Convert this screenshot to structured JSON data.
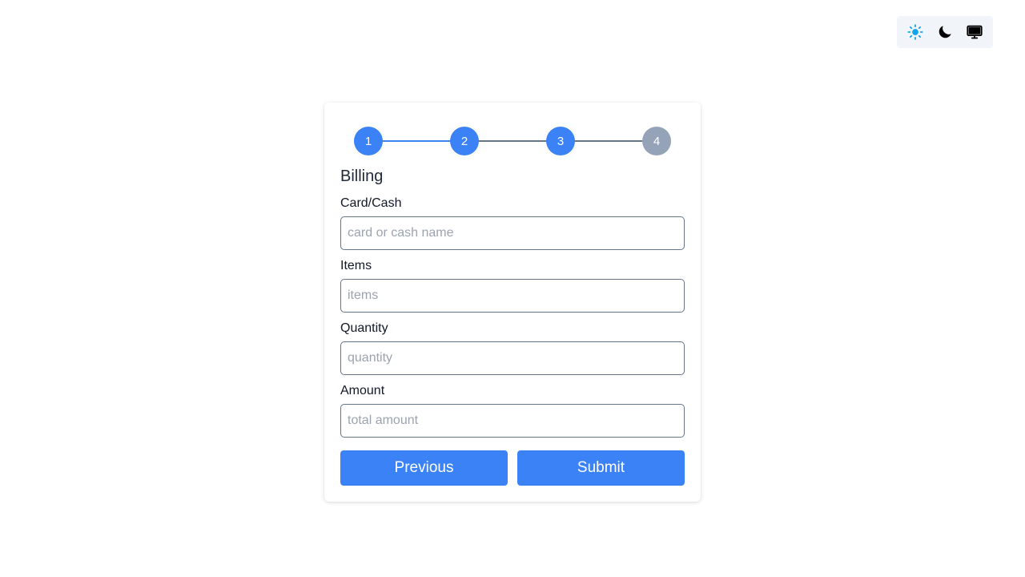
{
  "theme_switcher": {
    "options": [
      {
        "icon": "sun-icon",
        "active": true,
        "color": "#0ea5e9"
      },
      {
        "icon": "moon-icon",
        "active": false
      },
      {
        "icon": "monitor-icon",
        "active": false
      }
    ]
  },
  "stepper": {
    "steps": [
      "1",
      "2",
      "3",
      "4"
    ],
    "current_step": 3,
    "active_color": "#3b82f6",
    "pending_color": "#94a3b8"
  },
  "form": {
    "title": "Billing",
    "fields": [
      {
        "label": "Card/Cash",
        "placeholder": "card or cash name",
        "value": ""
      },
      {
        "label": "Items",
        "placeholder": "items",
        "value": ""
      },
      {
        "label": "Quantity",
        "placeholder": "quantity",
        "value": ""
      },
      {
        "label": "Amount",
        "placeholder": "total amount",
        "value": ""
      }
    ],
    "previous_label": "Previous",
    "submit_label": "Submit"
  }
}
